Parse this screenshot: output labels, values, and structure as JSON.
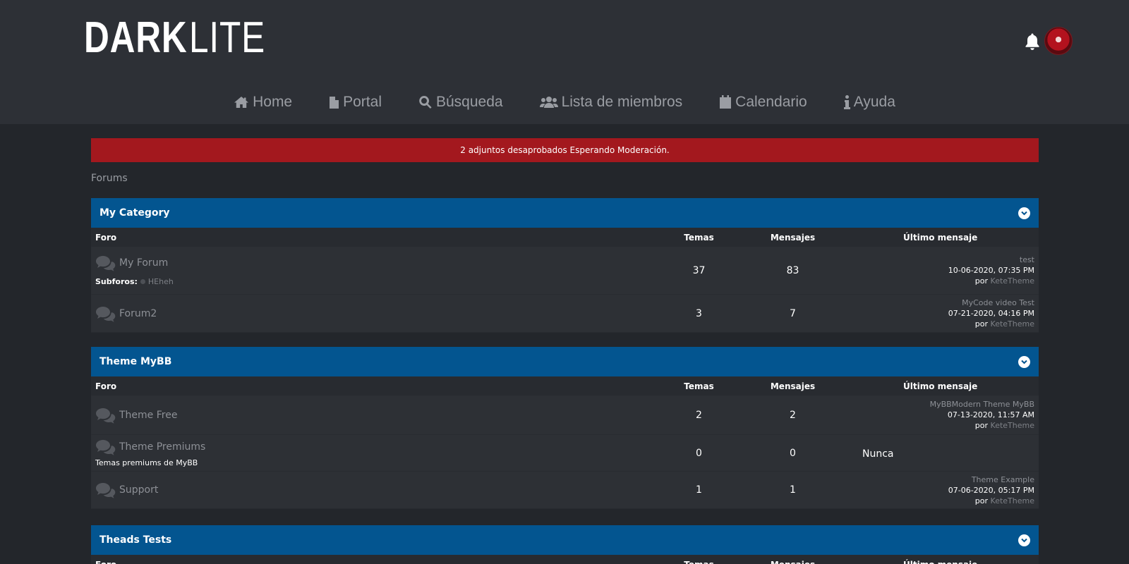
{
  "header": {
    "logo_bold": "DARK",
    "logo_thin": "LITE",
    "nav": [
      {
        "label": "Home",
        "icon": "home-icon"
      },
      {
        "label": "Portal",
        "icon": "file-icon"
      },
      {
        "label": "Búsqueda",
        "icon": "search-icon"
      },
      {
        "label": "Lista de miembros",
        "icon": "users-icon"
      },
      {
        "label": "Calendario",
        "icon": "calendar-icon"
      },
      {
        "label": "Ayuda",
        "icon": "info-icon"
      }
    ]
  },
  "notice": {
    "text": "2 adjuntos desaprobados Esperando Moderación."
  },
  "breadcrumb": {
    "text": "Forums"
  },
  "columns": {
    "forum": "Foro",
    "temas": "Temas",
    "mensajes": "Mensajes",
    "ultimo": "Último mensaje"
  },
  "categories": [
    {
      "title": "My Category",
      "forums": [
        {
          "name": "My Forum",
          "subforos_label": "Subforos:",
          "subforum": "HEheh",
          "temas": "37",
          "mensajes": "83",
          "last": {
            "title": "test",
            "date": "10-06-2020, 07:35 PM",
            "por": "por",
            "user": "KeteTheme"
          }
        },
        {
          "name": "Forum2",
          "temas": "3",
          "mensajes": "7",
          "last": {
            "title": "MyCode video Test",
            "date": "07-21-2020, 04:16 PM",
            "por": "por",
            "user": "KeteTheme"
          }
        }
      ]
    },
    {
      "title": "Theme MyBB",
      "forums": [
        {
          "name": "Theme Free",
          "temas": "2",
          "mensajes": "2",
          "last": {
            "title": "MyBBModern Theme MyBB",
            "date": "07-13-2020, 11:57 AM",
            "por": "por",
            "user": "KeteTheme"
          }
        },
        {
          "name": "Theme Premiums",
          "desc": "Temas premiums de MyBB",
          "temas": "0",
          "mensajes": "0",
          "never": "Nunca"
        },
        {
          "name": "Support",
          "temas": "1",
          "mensajes": "1",
          "last": {
            "title": "Theme Example",
            "date": "07-06-2020, 05:17 PM",
            "por": "por",
            "user": "KeteTheme"
          }
        }
      ]
    },
    {
      "title": "Theads Tests",
      "forums": []
    }
  ]
}
